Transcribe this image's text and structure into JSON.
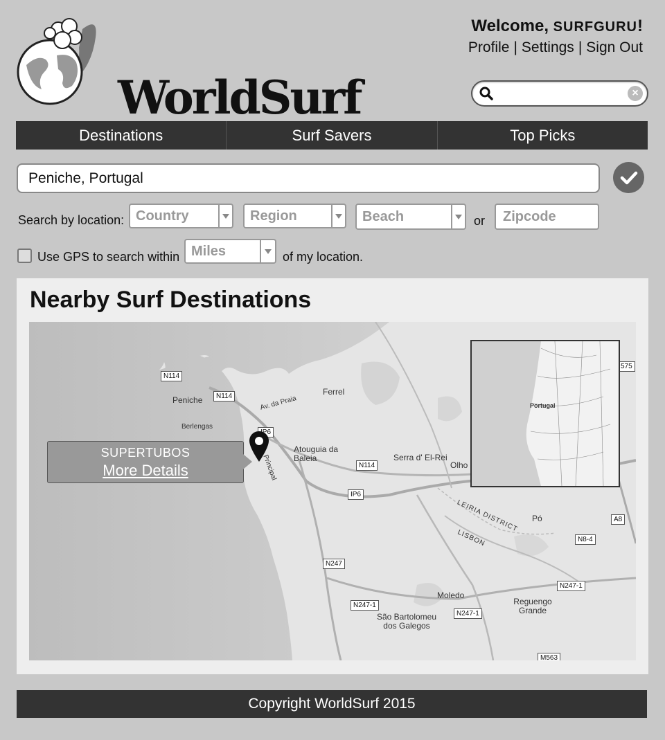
{
  "brand": {
    "name": "WorldSurf"
  },
  "header": {
    "welcome_prefix": "Welcome, ",
    "username": "SURFGURU",
    "welcome_suffix": "!",
    "links": {
      "profile": "Profile",
      "settings": "Settings",
      "sign_out": "Sign Out"
    },
    "separator": "|"
  },
  "search": {
    "value": "",
    "placeholder": ""
  },
  "nav": {
    "items": [
      "Destinations",
      "Surf Savers",
      "Top Picks"
    ]
  },
  "location": {
    "value": "Peniche, Portugal"
  },
  "filters": {
    "label": "Search by location:",
    "country": "Country",
    "region": "Region",
    "beach": "Beach",
    "or": "or",
    "zipcode_placeholder": "Zipcode"
  },
  "gps": {
    "label": "Use GPS to search within",
    "unit": "Miles",
    "suffix": "of my location.",
    "checked": false
  },
  "results": {
    "title": "Nearby Surf Destinations",
    "popup": {
      "title": "SUPERTUBOS",
      "link": "More Details"
    },
    "map_labels": {
      "places": [
        "Peniche",
        "Berlengas",
        "Ferrel",
        "Atouguia da Baleia",
        "Serra d' El-Rei",
        "Olho",
        "Pó",
        "Moledo",
        "Reguengo Grande",
        "São Bartolomeu dos Galegos",
        "Av. da Praia",
        "Principal",
        "LEIRIA DISTRICT",
        "LISBON"
      ],
      "roads": [
        "N114",
        "N114",
        "IP6",
        "N114",
        "IP6",
        "N247",
        "N247-1",
        "N247-1",
        "N247-1",
        "N8-4",
        "A8",
        "M563",
        "575"
      ],
      "inset": [
        "Portugal"
      ]
    }
  },
  "footer": {
    "text": "Copyright WorldSurf 2015"
  },
  "colors": {
    "nav_bg": "#333333",
    "footer_bg": "#333333",
    "page_bg": "#c8c8c8",
    "panel_bg": "#eeeeee",
    "confirm_bg": "#666666"
  }
}
